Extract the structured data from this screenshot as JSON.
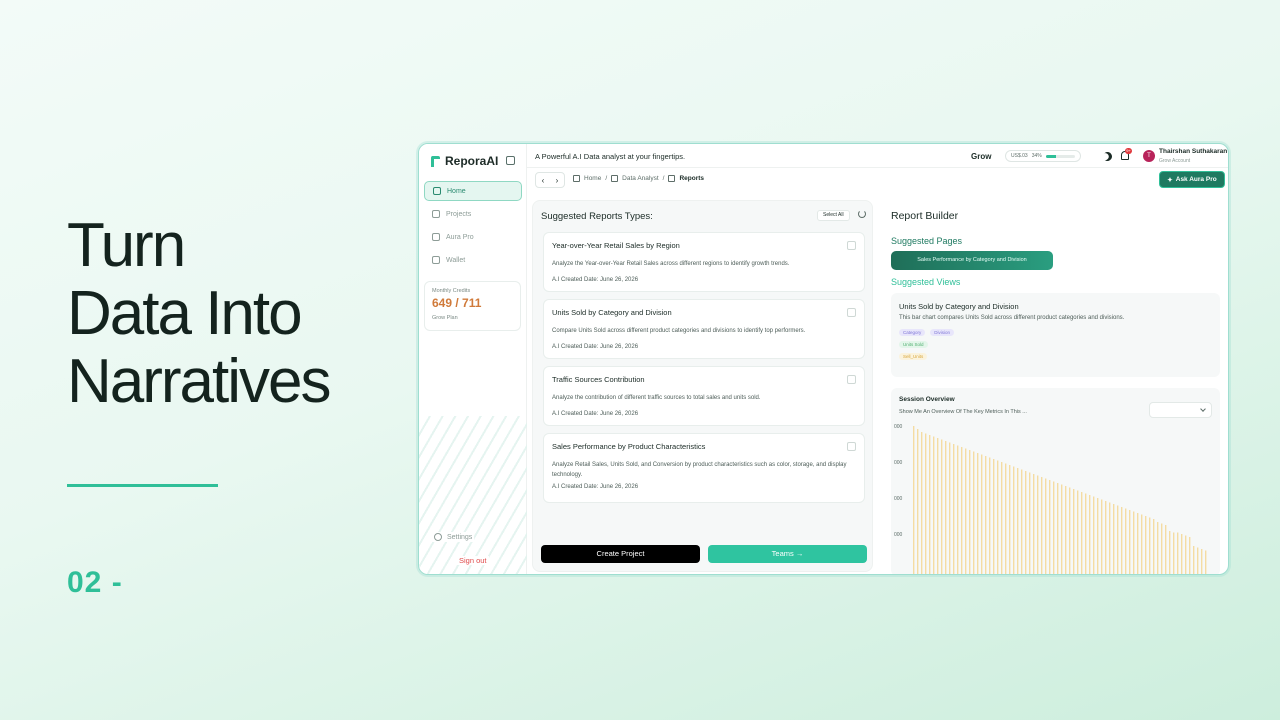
{
  "hero": {
    "lines": [
      "Turn",
      "Data Into",
      "Narratives"
    ],
    "number": "02 -"
  },
  "app": {
    "logo": "ReporaAI",
    "tagline": "A Powerful A.I Data analyst at your fingertips.",
    "sidebar": {
      "items": [
        {
          "label": "Home",
          "icon": "home-icon"
        },
        {
          "label": "Projects",
          "icon": "projects-icon"
        },
        {
          "label": "Aura Pro",
          "icon": "sparkle-icon"
        },
        {
          "label": "Wallet",
          "icon": "wallet-icon"
        }
      ],
      "credits_label": "Monthly Credits",
      "credits_value": "649 / 711",
      "plan": "Grow Plan",
      "settings": "Settings",
      "signout": "Sign out"
    },
    "topbar": {
      "grow": "Grow",
      "usage_amount": "US$.03",
      "usage_percent_text": "34%",
      "usage_fraction": 0.34,
      "notif_count": "9+",
      "avatar_letter": "T",
      "user_name": "Thairshan Suthakaran",
      "user_role": "Grow Account"
    },
    "breadcrumb": {
      "home": "Home",
      "sep1": "/",
      "analyst": "Data Analyst",
      "sep2": "/",
      "current": "Reports"
    },
    "ask_button": "Ask Aura Pro",
    "reports": {
      "title": "Suggested Reports Types:",
      "select_all": "Select All",
      "cards": [
        {
          "title": "Year-over-Year Retail Sales by Region",
          "desc": "Analyze the Year-over-Year Retail Sales across different regions to identify growth trends.",
          "date": "A.I Created Date: June 26, 2026"
        },
        {
          "title": "Units Sold by Category and Division",
          "desc": "Compare Units Sold across different product categories and divisions to identify top performers.",
          "date": "A.I Created Date: June 26, 2026"
        },
        {
          "title": "Traffic Sources Contribution",
          "desc": "Analyze the contribution of different traffic sources to total sales and units sold.",
          "date": "A.I Created Date: June 26, 2026"
        },
        {
          "title": "Sales Performance by Product Characteristics",
          "desc": "Analyze Retail Sales, Units Sold, and Conversion by product characteristics such as color, storage, and display technology.",
          "date": "A.I Created Date: June 26, 2026"
        }
      ],
      "create_button": "Create Project",
      "teams_button": "Teams →"
    },
    "builder": {
      "title": "Report Builder",
      "suggested_pages": "Suggested Pages",
      "page_pill": "Sales Performance by Category and Division",
      "suggested_views": "Suggested Views",
      "view_title": "Units Sold by Category and Division",
      "view_desc": "This bar chart compares Units Sold across different product categories and divisions.",
      "tags": [
        "Category",
        "Division",
        "Units Sold",
        "Sell_Units"
      ],
      "session_title": "Session Overview",
      "session_sub": "Show Me An Overview Of The Key Metrics In This ...",
      "y_ticks": [
        "000",
        "000",
        "000",
        "000"
      ]
    }
  },
  "colors": {
    "accent": "#2fbf98",
    "dark_green": "#1f7a61",
    "credits": "#d07a3a",
    "signout": "#e04b4b"
  },
  "chart_data": {
    "type": "bar",
    "values": [
      100,
      98,
      96,
      95,
      94,
      93,
      92,
      91,
      90,
      89,
      88,
      87,
      86,
      85,
      84,
      83,
      82,
      81,
      80,
      79,
      78,
      77,
      76,
      75,
      74,
      73,
      72,
      71,
      70,
      69,
      68,
      67,
      66,
      65,
      64,
      63,
      62,
      61,
      60,
      59,
      58,
      57,
      56,
      55,
      54,
      53,
      52,
      51,
      50,
      49,
      48,
      47,
      46,
      45,
      44,
      43,
      42,
      41,
      40,
      39,
      38,
      36,
      35,
      34,
      30,
      29,
      29,
      28,
      27,
      26,
      20,
      19,
      18,
      17
    ],
    "ylim": [
      0,
      100
    ],
    "bar_color": "#f4dca3",
    "grid": false
  }
}
